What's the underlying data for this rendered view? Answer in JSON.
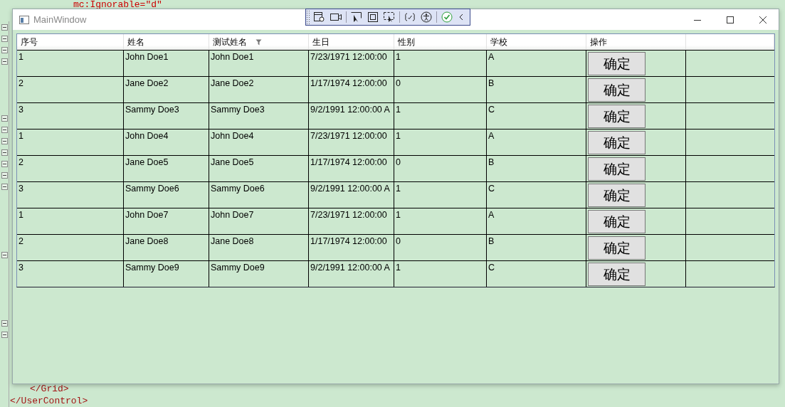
{
  "editor": {
    "lines": [
      {
        "kind": "attr",
        "text": "mc:Ignorable=\"d\""
      },
      {
        "kind": "close",
        "text": "</Grid>"
      },
      {
        "kind": "close",
        "text": "</UserControl>"
      }
    ]
  },
  "window": {
    "title": "MainWindow"
  },
  "table": {
    "columns": [
      {
        "label": "序号",
        "filter": false
      },
      {
        "label": "姓名",
        "filter": false
      },
      {
        "label": "测试姓名",
        "filter": true
      },
      {
        "label": "生日",
        "filter": false
      },
      {
        "label": "性别",
        "filter": false
      },
      {
        "label": "学校",
        "filter": false
      },
      {
        "label": "操作",
        "filter": false
      }
    ],
    "rows": [
      {
        "cells": [
          "1",
          "John Doe1",
          "John Doe1",
          "7/23/1971 12:00:00",
          "1",
          "A"
        ],
        "button": "确定"
      },
      {
        "cells": [
          "2",
          "Jane Doe2",
          "Jane Doe2",
          "1/17/1974 12:00:00",
          "0",
          "B"
        ],
        "button": "确定"
      },
      {
        "cells": [
          "3",
          "Sammy Doe3",
          "Sammy Doe3",
          "9/2/1991 12:00:00 A",
          "1",
          "C"
        ],
        "button": "确定"
      },
      {
        "cells": [
          "1",
          "John Doe4",
          "John Doe4",
          "7/23/1971 12:00:00",
          "1",
          "A"
        ],
        "button": "确定"
      },
      {
        "cells": [
          "2",
          "Jane Doe5",
          "Jane Doe5",
          "1/17/1974 12:00:00",
          "0",
          "B"
        ],
        "button": "确定"
      },
      {
        "cells": [
          "3",
          "Sammy Doe6",
          "Sammy Doe6",
          "9/2/1991 12:00:00 A",
          "1",
          "C"
        ],
        "button": "确定"
      },
      {
        "cells": [
          "1",
          "John Doe7",
          "John Doe7",
          "7/23/1971 12:00:00",
          "1",
          "A"
        ],
        "button": "确定"
      },
      {
        "cells": [
          "2",
          "Jane Doe8",
          "Jane Doe8",
          "1/17/1974 12:00:00",
          "0",
          "B"
        ],
        "button": "确定"
      },
      {
        "cells": [
          "3",
          "Sammy Doe9",
          "Sammy Doe9",
          "9/2/1991 12:00:00 A",
          "1",
          "C"
        ],
        "button": "确定"
      }
    ]
  }
}
